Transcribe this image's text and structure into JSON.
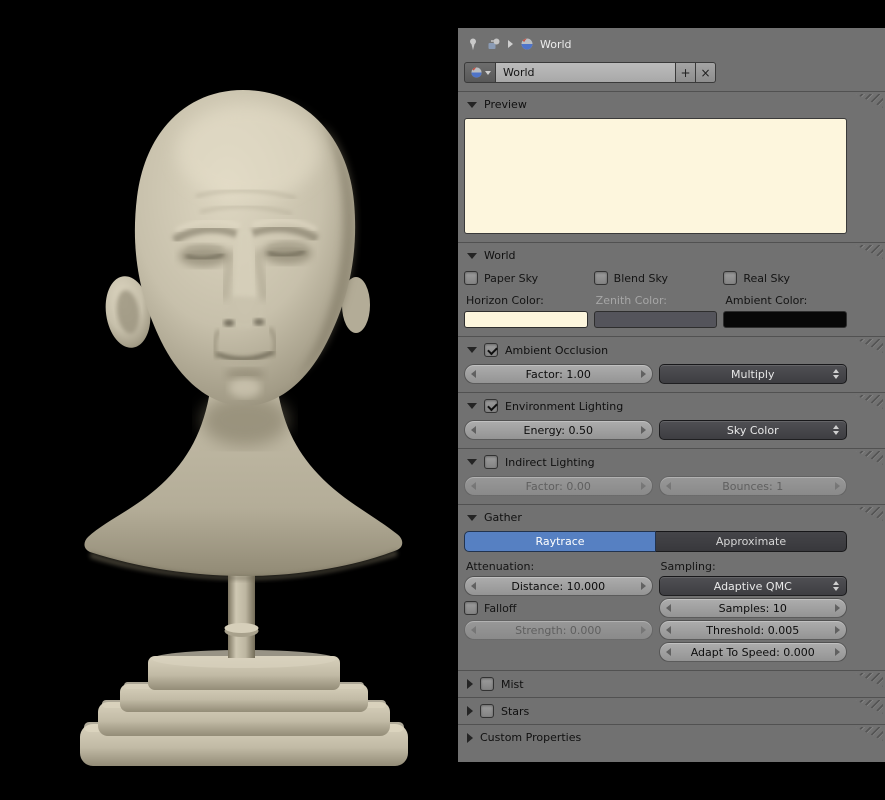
{
  "icons": {
    "add": "+",
    "delete": "×"
  },
  "colors": {
    "accent_blue": "#5680c2",
    "preview_bg": "#fdf6dd",
    "horizon_color": "#fdf6dd",
    "zenith_color": "#54545b",
    "ambient_color": "#070707"
  },
  "header": {
    "breadcrumb_label": "World"
  },
  "id_block": {
    "name_value": "World"
  },
  "preview": {
    "title": "Preview"
  },
  "world": {
    "title": "World",
    "paper_sky_label": "Paper Sky",
    "paper_sky_checked": false,
    "blend_sky_label": "Blend Sky",
    "blend_sky_checked": false,
    "real_sky_label": "Real Sky",
    "real_sky_checked": false,
    "horizon_label": "Horizon Color:",
    "zenith_label": "Zenith Color:",
    "ambient_label": "Ambient Color:"
  },
  "ambient_occlusion": {
    "title": "Ambient Occlusion",
    "enabled": true,
    "factor_value": "Factor: 1.00",
    "blend_mode_value": "Multiply"
  },
  "environment_lighting": {
    "title": "Environment Lighting",
    "enabled": true,
    "energy_value": "Energy: 0.50",
    "source_value": "Sky Color"
  },
  "indirect_lighting": {
    "title": "Indirect Lighting",
    "enabled": false,
    "factor_value": "Factor: 0.00",
    "bounces_value": "Bounces: 1"
  },
  "gather": {
    "title": "Gather",
    "raytrace_label": "Raytrace",
    "approximate_label": "Approximate",
    "active_method": "Raytrace",
    "attenuation_label": "Attenuation:",
    "sampling_label": "Sampling:",
    "distance_value": "Distance: 10.000",
    "falloff_label": "Falloff",
    "falloff_checked": false,
    "strength_value": "Strength: 0.000",
    "sampling_method_value": "Adaptive QMC",
    "samples_value": "Samples: 10",
    "threshold_value": "Threshold: 0.005",
    "adapt_to_speed_value": "Adapt To Speed: 0.000"
  },
  "mist": {
    "title": "Mist",
    "enabled": false
  },
  "stars": {
    "title": "Stars",
    "enabled": false
  },
  "custom_properties": {
    "title": "Custom Properties"
  }
}
